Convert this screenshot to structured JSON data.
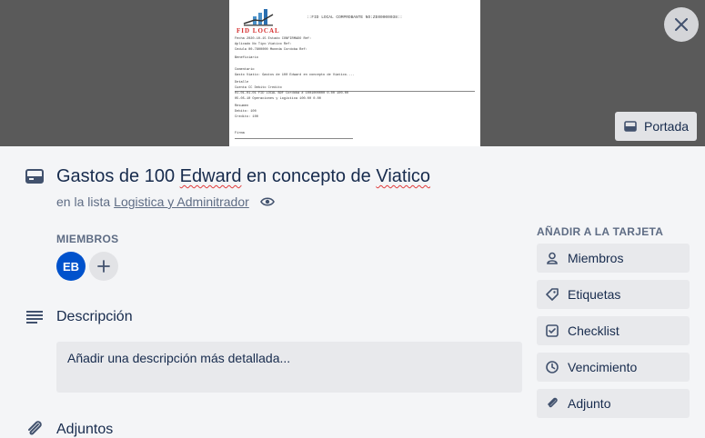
{
  "cover": {
    "document": {
      "logo_text": "FID LOCAL",
      "title": "::FID LOCAL COMPROBANTE NO:ZE00000038::",
      "rows": [
        "Fecha    2020-10-15      Estado   CONFIRMADO     Ref:",
        "Aplicado  No              Tipo     Viatico        Ref:",
        "Cedula   00-7800000       Moneda   Cordoba        Ref:",
        "Beneficiario",
        "Comentario",
        "Gasto Viatic: Gastos de 100 Edward en concepto de Viatico....",
        "Detalle",
        "Cuenta                      CC                         Debito        Credito",
        "01-01-01-01 FID LOCAL BDF Cordoba # 1001000000             0.00         100.00",
        "05-05-10 Operaciones y Logistica                          100.00           0.00",
        "Resumen",
        "Debito:   100",
        "Credito:  100",
        "Firma"
      ]
    },
    "portada_label": "Portada"
  },
  "card": {
    "title_prefix": "Gastos de 100 ",
    "title_edward": "Edward",
    "title_middle": " en concepto de ",
    "title_viatico": "Viatico",
    "list_prefix": "en la lista",
    "list_name": "Logistica y Adminitrador"
  },
  "members": {
    "label": "MIEMBROS",
    "avatar_initials": "EB"
  },
  "description": {
    "heading": "Descripción",
    "placeholder": "Añadir una descripción más detallada..."
  },
  "attachments": {
    "heading": "Adjuntos"
  },
  "sidebar": {
    "label": "AÑADIR A LA TARJETA",
    "buttons": [
      {
        "label": "Miembros",
        "icon": "user-icon"
      },
      {
        "label": "Etiquetas",
        "icon": "tag-icon"
      },
      {
        "label": "Checklist",
        "icon": "checklist-icon"
      },
      {
        "label": "Vencimiento",
        "icon": "clock-icon"
      },
      {
        "label": "Adjunto",
        "icon": "paperclip-icon"
      }
    ]
  },
  "colors": {
    "avatar": "#0052cc",
    "text": "#172b4d",
    "muted": "#5e6c84",
    "panel": "#f4f5f7"
  }
}
